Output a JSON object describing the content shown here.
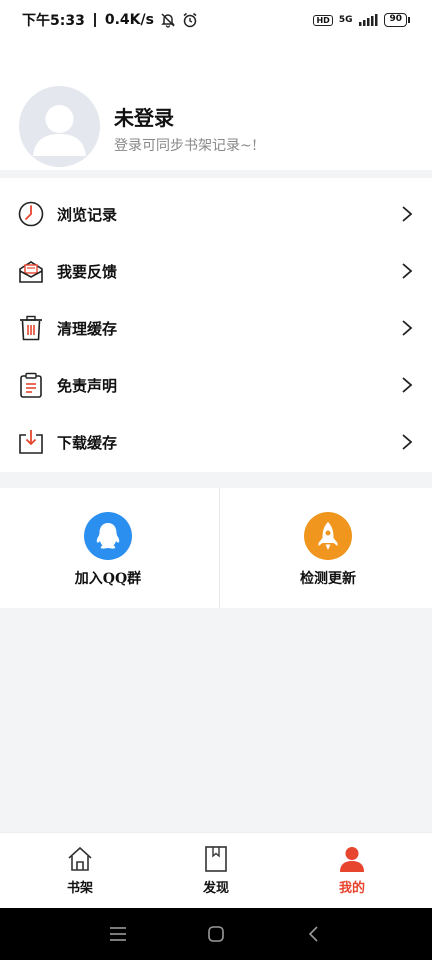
{
  "status_bar": {
    "time": "下午5:33",
    "speed": "0.4K/s",
    "hd": "HD",
    "network": "5G",
    "battery": "90"
  },
  "profile": {
    "name": "未登录",
    "subtitle": "登录可同步书架记录~!"
  },
  "menu": [
    {
      "label": "浏览记录",
      "icon": "clock-icon"
    },
    {
      "label": "我要反馈",
      "icon": "mail-icon"
    },
    {
      "label": "清理缓存",
      "icon": "trash-icon"
    },
    {
      "label": "免责声明",
      "icon": "clipboard-icon"
    },
    {
      "label": "下载缓存",
      "icon": "download-icon"
    }
  ],
  "actions": [
    {
      "label": "加入QQ群",
      "icon": "qq-icon",
      "color": "#2b8ff0"
    },
    {
      "label": "检测更新",
      "icon": "rocket-icon",
      "color": "#f0961e"
    }
  ],
  "tabs": [
    {
      "label": "书架",
      "icon": "home-icon",
      "active": false
    },
    {
      "label": "发现",
      "icon": "book-icon",
      "active": false
    },
    {
      "label": "我的",
      "icon": "user-icon",
      "active": true
    }
  ],
  "colors": {
    "accent": "#e8452e",
    "text": "#111111",
    "muted": "#888888"
  }
}
